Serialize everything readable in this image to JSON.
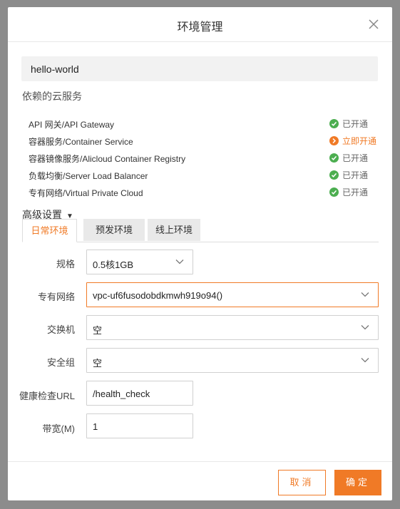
{
  "dialog": {
    "title": "环境管理",
    "app_name": "hello-world",
    "dependencies_label": "依赖的云服务",
    "services": [
      {
        "name": "API 网关/API Gateway",
        "status": "已开通",
        "state": "enabled"
      },
      {
        "name": "容器服务/Container Service",
        "status": "立即开通",
        "state": "action"
      },
      {
        "name": "容器镜像服务/Alicloud Container Registry",
        "status": "已开通",
        "state": "enabled"
      },
      {
        "name": "负载均衡/Server Load Balancer",
        "status": "已开通",
        "state": "enabled"
      },
      {
        "name": "专有网络/Virtual Private Cloud",
        "status": "已开通",
        "state": "enabled"
      }
    ],
    "advanced_label": "高级设置",
    "advanced_caret": "▼",
    "tabs": [
      {
        "label": "日常环境",
        "active": true
      },
      {
        "label": "预发环境",
        "active": false
      },
      {
        "label": "线上环境",
        "active": false
      }
    ],
    "form": {
      "spec_label": "规格",
      "spec_value": "0.5核1GB",
      "vpc_label": "专有网络",
      "vpc_value": "vpc-uf6fusodobdkmwh919o94()",
      "vswitch_label": "交换机",
      "vswitch_value": "空",
      "secgroup_label": "安全组",
      "secgroup_value": "空",
      "health_label": "健康检查URL",
      "health_value": "/health_check",
      "bandwidth_label": "带宽(M)",
      "bandwidth_value": "1"
    },
    "cancel_label": "取消",
    "confirm_label": "确定"
  },
  "colors": {
    "accent": "#f07a26",
    "enabled_green": "#4cae50"
  }
}
